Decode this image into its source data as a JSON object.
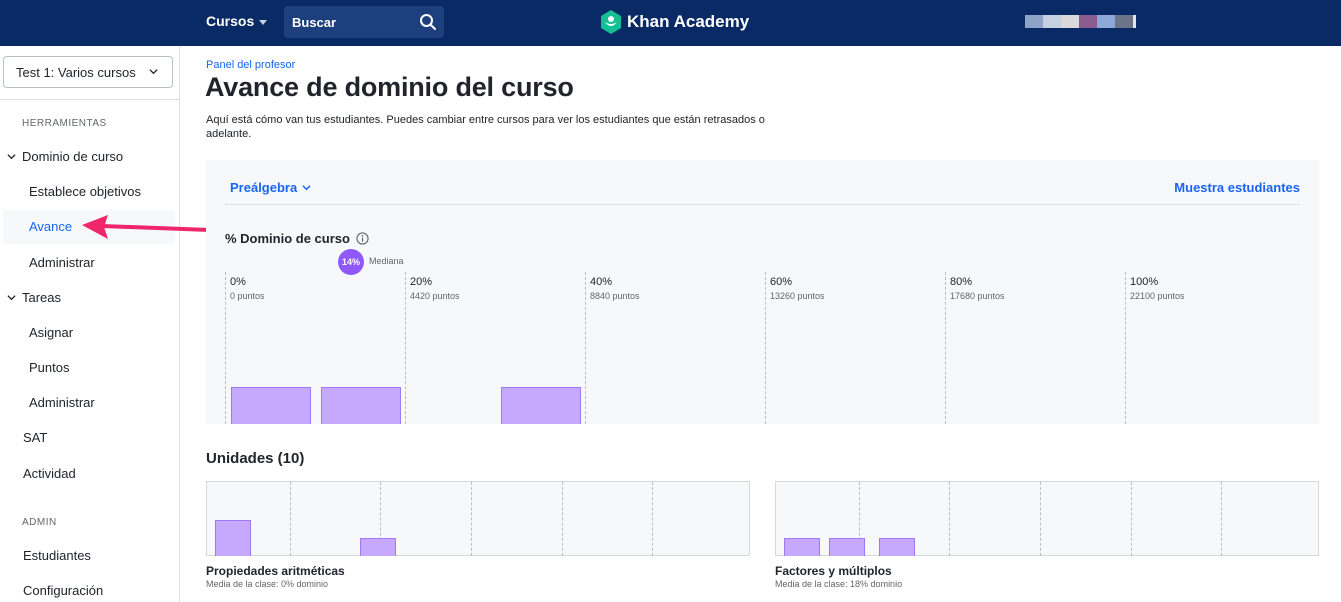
{
  "header": {
    "courses_label": "Cursos",
    "search_placeholder": "Buscar",
    "logo_text": "Khan Academy",
    "brand_color": "#0a2a66"
  },
  "sidebar": {
    "course_select_value": "Test 1: Varios cursos",
    "tools_heading": "HERRAMIENTAS",
    "course_mastery": "Dominio de curso",
    "set_goals": "Establece objetivos",
    "progress": "Avance",
    "manage_mastery": "Administrar",
    "assignments": "Tareas",
    "assign": "Asignar",
    "points": "Puntos",
    "manage_assignments": "Administrar",
    "sat": "SAT",
    "activity": "Actividad",
    "admin_heading": "ADMIN",
    "students": "Estudiantes",
    "settings": "Configuración"
  },
  "main": {
    "breadcrumb": "Panel del profesor",
    "title": "Avance de dominio del curso",
    "description": "Aquí está cómo van tus estudiantes. Puedes cambiar entre cursos para ver los estudiantes que están retrasados o adelante.",
    "subject_selector": "Preálgebra",
    "show_students": "Muestra estudiantes",
    "metric_label": "% Dominio de curso",
    "median_value": "14%",
    "median_label": "Mediana",
    "units_title": "Unidades (10)"
  },
  "chart_data": [
    {
      "type": "bar",
      "title": "% Dominio de curso",
      "x_ticks": [
        {
          "pct": "0%",
          "points": "0 puntos"
        },
        {
          "pct": "20%",
          "points": "4420 puntos"
        },
        {
          "pct": "40%",
          "points": "8840 puntos"
        },
        {
          "pct": "60%",
          "points": "13260 puntos"
        },
        {
          "pct": "80%",
          "points": "17680 puntos"
        },
        {
          "pct": "100%",
          "points": "22100 puntos"
        }
      ],
      "xlim": [
        0,
        100
      ],
      "bins": [
        {
          "from": 0,
          "to": 10,
          "count": 1
        },
        {
          "from": 10,
          "to": 20,
          "count": 1
        },
        {
          "from": 30,
          "to": 40,
          "count": 1
        }
      ],
      "median": 14
    },
    {
      "type": "bar",
      "title": "Propiedades aritméticas",
      "subtitle": "Media de la clase: 0% dominio",
      "bins": [
        {
          "from": 0,
          "to": 6.7,
          "count": 2
        },
        {
          "from": 26.7,
          "to": 33.3,
          "count": 1
        }
      ]
    },
    {
      "type": "bar",
      "title": "Factores y múltiplos",
      "subtitle": "Media de la clase: 18% dominio",
      "bins": [
        {
          "from": 0,
          "to": 6.7,
          "count": 1
        },
        {
          "from": 8.3,
          "to": 15,
          "count": 1
        },
        {
          "from": 17.5,
          "to": 24.2,
          "count": 1
        }
      ]
    }
  ]
}
